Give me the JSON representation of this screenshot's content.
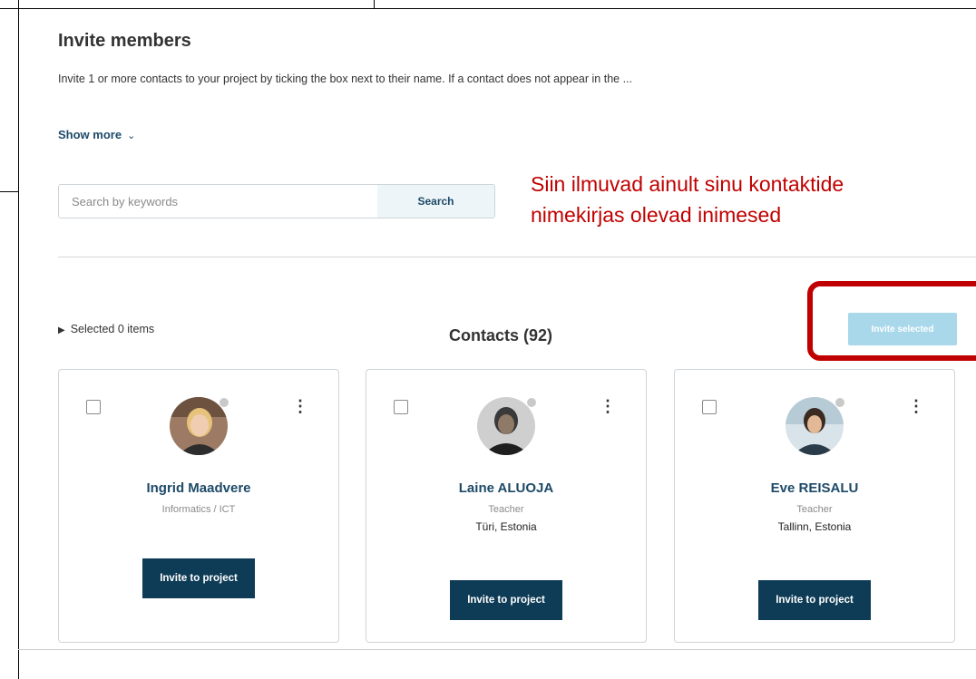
{
  "header": {
    "title": "Invite members",
    "intro": "Invite 1 or more contacts to your project by ticking the box next to their name. If a contact does not appear in the ...",
    "show_more": "Show more",
    "show_more_icon": "chevron-down-icon"
  },
  "search": {
    "placeholder": "Search by keywords",
    "value": "",
    "button_label": "Search"
  },
  "annotation": {
    "line1": "Siin ilmuvad ainult sinu kontaktide",
    "line2": "nimekirjas olevad inimesed",
    "color": "#c00000"
  },
  "toolbar": {
    "selected_label": "Selected 0 items",
    "contacts_title": "Contacts (92)",
    "invite_selected": "Invite selected"
  },
  "contacts": [
    {
      "name": "Ingrid Maadvere",
      "role": "Informatics / ICT",
      "location": "",
      "invite_label": "Invite to project",
      "checked": false
    },
    {
      "name": "Laine ALUOJA",
      "role": "Teacher",
      "location": "Türi, Estonia",
      "invite_label": "Invite to project",
      "checked": false
    },
    {
      "name": "Eve REISALU",
      "role": "Teacher",
      "location": "Tallinn, Estonia",
      "invite_label": "Invite to project",
      "checked": false
    }
  ],
  "colors": {
    "accent": "#1d4a68",
    "button_dark": "#0e3c56",
    "button_disabled": "#a9d8ea",
    "highlight": "#c00000"
  }
}
